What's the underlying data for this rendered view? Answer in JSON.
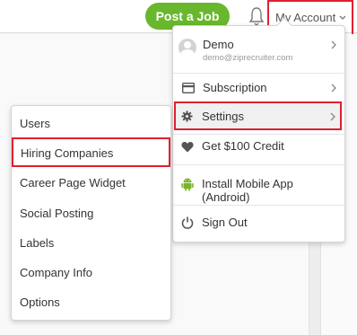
{
  "header": {
    "post_job_label": "Post a Job",
    "my_account_label": "My Account"
  },
  "account_menu": {
    "user": {
      "name": "Demo",
      "email": "demo@ziprecruiter.com"
    },
    "items": [
      {
        "label": "Subscription",
        "icon": "credit-card-icon"
      },
      {
        "label": "Settings",
        "icon": "gear-icon"
      },
      {
        "label": "Get $100 Credit",
        "icon": "heart-icon"
      },
      {
        "label": "Install Mobile App (Android)",
        "icon": "android-icon"
      },
      {
        "label": "Sign Out",
        "icon": "power-icon"
      }
    ]
  },
  "settings_submenu": {
    "items": [
      "Users",
      "Hiring Companies",
      "Career Page Widget",
      "Social Posting",
      "Labels",
      "Company Info",
      "Options"
    ]
  },
  "colors": {
    "brand_green": "#68b72c",
    "highlight_red": "#e02030"
  }
}
